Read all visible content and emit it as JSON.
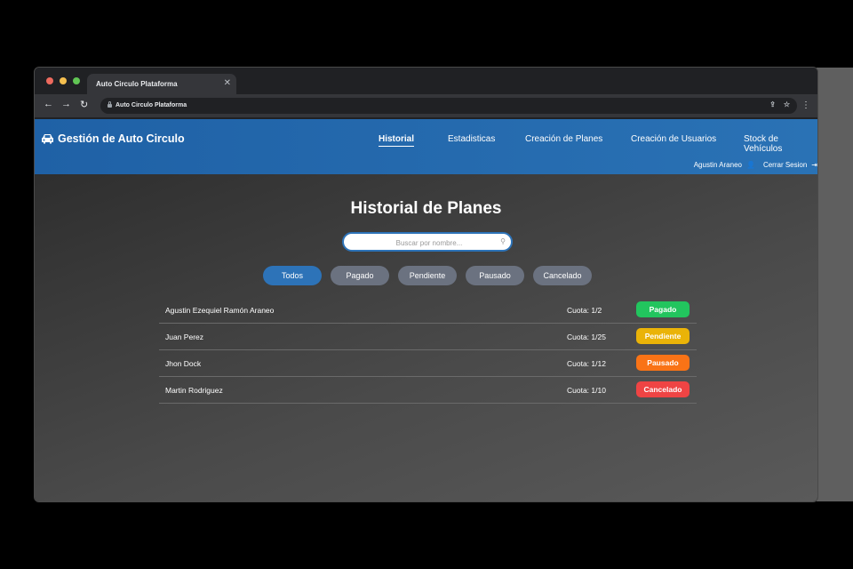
{
  "browser": {
    "tab_title": "Auto Circulo Plataforma",
    "address": "Auto Circulo Plataforma"
  },
  "app": {
    "brand": "Gestión de Auto Circulo",
    "nav": [
      "Historial",
      "Estadisticas",
      "Creación de Planes",
      "Creación de Usuarios",
      "Stock de Vehículos"
    ],
    "user_name": "Agustin Araneo",
    "logout": "Cerrar Sesion"
  },
  "main": {
    "title": "Historial de Planes",
    "search_placeholder": "Buscar por nombre...",
    "filters": [
      "Todos",
      "Pagado",
      "Pendiente",
      "Pausado",
      "Cancelado"
    ],
    "active_filter": "Todos",
    "rows": [
      {
        "name": "Agustin Ezequiel Ramón Araneo",
        "cuota": "Cuota: 1/2",
        "status": "Pagado",
        "color": "#22c55e"
      },
      {
        "name": "Juan Perez",
        "cuota": "Cuota: 1/25",
        "status": "Pendiente",
        "color": "#eab308"
      },
      {
        "name": "Jhon Dock",
        "cuota": "Cuota: 1/12",
        "status": "Pausado",
        "color": "#f97316"
      },
      {
        "name": "Martin Rodriguez",
        "cuota": "Cuota: 1/10",
        "status": "Cancelado",
        "color": "#ef4444"
      }
    ]
  },
  "colors": {
    "header": "#2a6db0",
    "accent": "#2d73b8",
    "filter_inactive": "#6b7280"
  }
}
